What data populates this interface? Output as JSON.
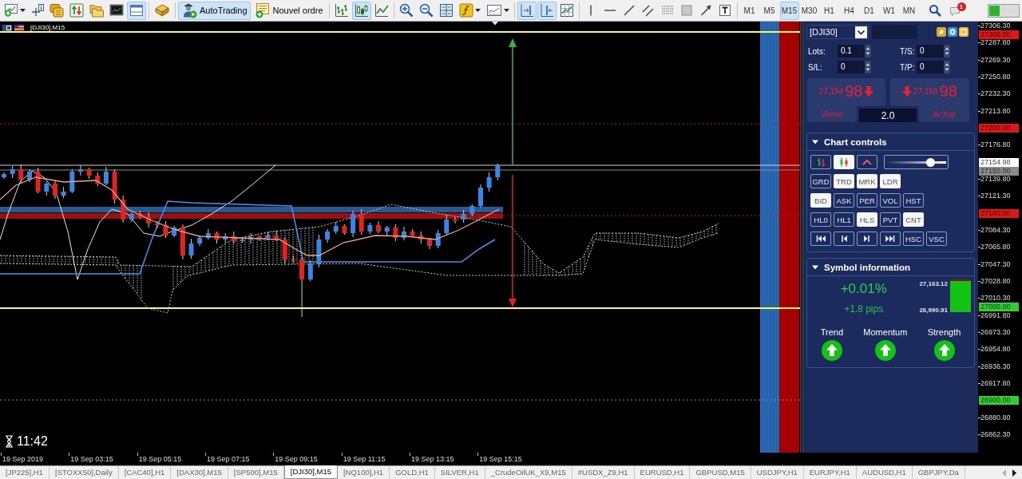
{
  "toolbar": {
    "window_buttons": [
      {
        "selected": false
      },
      {
        "selected": false
      },
      {
        "selected": false
      },
      {
        "selected": false
      },
      {
        "selected": false
      },
      {
        "selected": false
      },
      {
        "selected": true
      }
    ],
    "tester_buttons": [
      {
        "selected": false
      }
    ],
    "trading_buttons": [
      {
        "label": "AutoTrading",
        "selected": true
      },
      {
        "label": "Nouvel ordre",
        "selected": false
      }
    ],
    "chart_type_buttons": [
      {
        "selected": false
      },
      {
        "selected": true
      },
      {
        "selected": false
      }
    ],
    "view_buttons": [
      {
        "selected": false
      },
      {
        "selected": false
      },
      {
        "selected": false
      },
      {
        "selected": false
      },
      {
        "selected": false
      }
    ],
    "scroll_buttons": [
      {
        "selected": true
      },
      {
        "selected": true
      },
      {
        "selected": false
      }
    ],
    "drawing_buttons": [
      {
        "selected": false
      },
      {
        "selected": false
      },
      {
        "selected": false
      },
      {
        "selected": false
      },
      {
        "selected": false
      },
      {
        "selected": false
      },
      {
        "selected": false
      },
      {
        "selected": false
      }
    ],
    "timeframes": [
      {
        "label": "M1",
        "selected": false
      },
      {
        "label": "M5",
        "selected": false
      },
      {
        "label": "M15",
        "selected": true
      },
      {
        "label": "M30",
        "selected": false
      },
      {
        "label": "H1",
        "selected": false
      },
      {
        "label": "H4",
        "selected": false
      },
      {
        "label": "D1",
        "selected": false
      },
      {
        "label": "W1",
        "selected": false
      },
      {
        "label": "MN",
        "selected": false
      }
    ],
    "alerts_badge": "1"
  },
  "chart": {
    "title": "[DJI30],M15",
    "timer": "11:42",
    "price_axis": [
      {
        "label": "27306.30",
        "tags": [
          {
            "text": "27300.00",
            "color": "#e01515"
          }
        ]
      },
      {
        "label": "27287.80"
      },
      {
        "label": "27269.30"
      },
      {
        "label": "27250.80"
      },
      {
        "label": "27232.30"
      },
      {
        "label": "27213.80"
      },
      {
        "tags": [
          {
            "text": "27200.00",
            "color": "#e01515"
          }
        ]
      },
      {
        "label": "27176.80"
      },
      {
        "tags": [
          {
            "text": "27154.98",
            "color": "#ffffff"
          },
          {
            "text": "27150.00",
            "color": "#8c8c8c"
          }
        ]
      },
      {
        "label": "27139.80"
      },
      {
        "label": "27121.30"
      },
      {
        "tags": [
          {
            "text": "27100.00",
            "color": "#e01515"
          }
        ]
      },
      {
        "label": "27084.30"
      },
      {
        "label": "27065.80"
      },
      {
        "label": "27047.30"
      },
      {
        "label": "27028.80"
      },
      {
        "label": "27010.30",
        "tags": [
          {
            "text": "27000.00",
            "color": "#33cc33"
          }
        ]
      },
      {
        "label": "26991.80"
      },
      {
        "label": "26973.30"
      },
      {
        "label": "26954.80"
      },
      {
        "label": "26936.30"
      },
      {
        "label": "26917.80"
      },
      {
        "tags": [
          {
            "text": "26900.00",
            "color": "#33cc33"
          }
        ]
      },
      {
        "label": "26880.80"
      },
      {
        "label": "26862.30"
      }
    ],
    "time_axis": [
      "19 Sep 2019",
      "19 Sep 03:15",
      "19 Sep 05:15",
      "19 Sep 07:15",
      "19 Sep 09:15",
      "19 Sep 11:15",
      "19 Sep 13:15",
      "19 Sep 15:15"
    ]
  },
  "trade_panel": {
    "symbol": "[DJI30]",
    "fields": [
      {
        "label": "Lots:",
        "value": "0.1"
      },
      {
        "label": "T/S:",
        "value": "0"
      },
      {
        "label": "S/L:",
        "value": "0"
      },
      {
        "label": "T/P:",
        "value": "0"
      }
    ],
    "sell": {
      "price": "27,154",
      "pips": "98",
      "label": "Vente"
    },
    "buy": {
      "price": "27,156",
      "pips": "98",
      "label": "Achat"
    },
    "volume": "2.0"
  },
  "chart_controls": {
    "title": "Chart controls",
    "expanded": true,
    "style_buttons": [
      {
        "selected": false
      },
      {
        "selected": true
      },
      {
        "selected": false
      }
    ],
    "scale_slider": {
      "level": 0.74
    },
    "button_rows": [
      [
        {
          "kind": "text",
          "label": "GRD",
          "on": false
        },
        {
          "kind": "text",
          "label": "TRD",
          "on": true
        },
        {
          "kind": "text",
          "label": "MRK",
          "on": true
        },
        {
          "kind": "text",
          "label": "LDR",
          "on": true
        }
      ],
      [
        {
          "kind": "text",
          "label": "BID",
          "on": true
        },
        {
          "kind": "text",
          "label": "ASK",
          "on": false
        },
        {
          "kind": "text",
          "label": "PER",
          "on": false
        },
        {
          "kind": "text",
          "label": "VOL",
          "on": false
        },
        {
          "kind": "text",
          "label": "HST",
          "on": false
        }
      ],
      [
        {
          "kind": "text",
          "label": "HL0",
          "on": false
        },
        {
          "kind": "text",
          "label": "HL1",
          "on": false
        },
        {
          "kind": "text",
          "label": "HLS",
          "on": true
        },
        {
          "kind": "text",
          "label": "PVT",
          "on": false
        },
        {
          "kind": "text",
          "label": "CNT",
          "on": true
        }
      ],
      [
        {
          "kind": "icon",
          "on": false
        },
        {
          "kind": "icon",
          "on": false
        },
        {
          "kind": "icon",
          "on": false
        },
        {
          "kind": "icon",
          "on": false
        },
        {
          "kind": "text",
          "label": "HSC",
          "on": false
        },
        {
          "kind": "text",
          "label": "VSC",
          "on": false
        }
      ]
    ]
  },
  "symbol_information": {
    "title": "Symbol information",
    "expanded": true,
    "change": "+0.01%",
    "pips": "+1.8 pips",
    "high": "27,163.12",
    "low": "26,990.91",
    "range_meter": {
      "level": 0.95
    },
    "signals": [
      {
        "label": "Trend",
        "rising": true
      },
      {
        "label": "Momentum",
        "rising": true
      },
      {
        "label": "Strength",
        "rising": true
      }
    ]
  },
  "chart_tabs": [
    {
      "label": "[JP225],H1",
      "selected": false
    },
    {
      "label": "[STOXX50],Daily",
      "selected": false
    },
    {
      "label": "[CAC40],H1",
      "selected": false
    },
    {
      "label": "[DAX30],M15",
      "selected": false
    },
    {
      "label": "[SP500],M15",
      "selected": false
    },
    {
      "label": "[DJI30],M15",
      "selected": true
    },
    {
      "label": "[NQ100],H1",
      "selected": false
    },
    {
      "label": "GOLD,H1",
      "selected": false
    },
    {
      "label": "SILVER,H1",
      "selected": false
    },
    {
      "label": "_CrudeOilUK_X9,M15",
      "selected": false
    },
    {
      "label": "#USDX_Z9,H1",
      "selected": false
    },
    {
      "label": "EURUSD,H1",
      "selected": false
    },
    {
      "label": "GBPUSD,M15",
      "selected": false
    },
    {
      "label": "USDJPY,H1",
      "selected": false
    },
    {
      "label": "EURJPY,H1",
      "selected": false
    },
    {
      "label": "AUDUSD,H1",
      "selected": false
    },
    {
      "label": "GBPJPY,Da",
      "selected": false
    }
  ],
  "tab_scroll": [
    {
      "disabled": true
    },
    {
      "disabled": false
    }
  ]
}
